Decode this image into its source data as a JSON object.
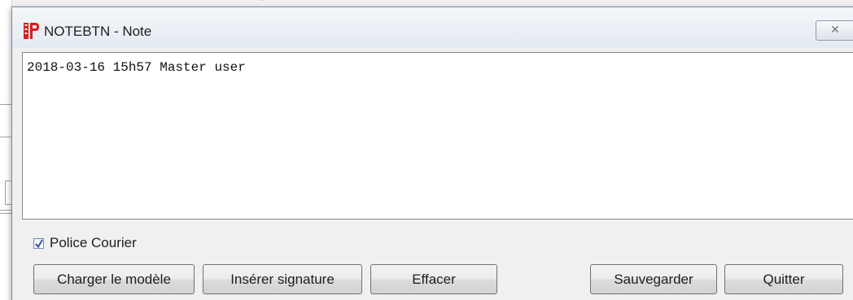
{
  "window": {
    "title": "NOTEBTN - Note",
    "close_glyph": "✕"
  },
  "note": {
    "content": "2018-03-16 15h57 Master user"
  },
  "options": {
    "courier_font_label": "Police Courier",
    "courier_font_checked": true
  },
  "buttons": {
    "load_template": "Charger le modèle",
    "insert_signature": "Insérer signature",
    "clear": "Effacer",
    "save": "Sauvegarder",
    "quit": "Quitter"
  },
  "colors": {
    "app_icon_red": "#d6201f",
    "checkbox_check": "#3b5ea8"
  }
}
